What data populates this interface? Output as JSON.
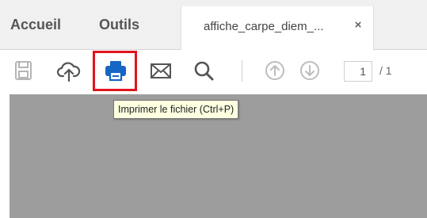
{
  "tabs": {
    "home_label": "Accueil",
    "tools_label": "Outils",
    "document_title": "affiche_carpe_diem_...",
    "close_symbol": "×"
  },
  "toolbar": {
    "icons": [
      "save-icon",
      "cloud-upload-icon",
      "print-icon",
      "mail-icon",
      "search-icon",
      "arrow-up-circle-icon",
      "arrow-down-circle-icon"
    ],
    "print_highlight_color": "#e0141e",
    "print_icon_color": "#1666c5",
    "current_page": "1",
    "page_total": "/ 1"
  },
  "tooltip": {
    "text": "Imprimer le fichier (Ctrl+P)"
  },
  "colors": {
    "tabbar_bg": "#f0f0f0",
    "document_area_bg": "#9d9d9d",
    "tooltip_bg": "#ffffe1"
  }
}
